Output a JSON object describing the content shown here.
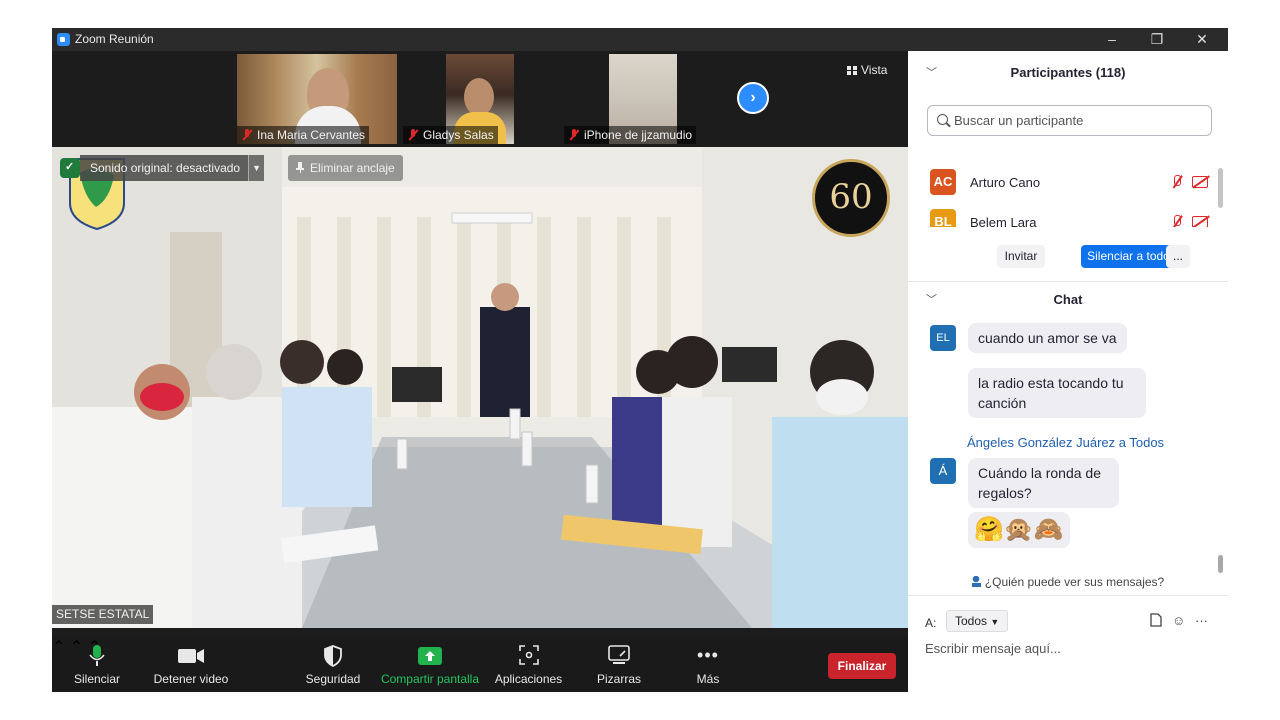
{
  "window": {
    "title": "Zoom Reunión",
    "controls": [
      "–",
      "❐",
      "✕"
    ]
  },
  "thumbnails": [
    {
      "name": "Ina Maria Cervantes"
    },
    {
      "name": "Gladys Salas"
    },
    {
      "name": "iPhone de jjzamudio"
    }
  ],
  "view_label": "Vista",
  "main_video": {
    "speaker": "SETSE ESTATAL",
    "original_sound": "Sonido original: desactivado",
    "unpin": "Eliminar anclaje",
    "badge_number": "60"
  },
  "toolbar": {
    "mute": "Silenciar",
    "stop_video": "Detener video",
    "security": "Seguridad",
    "share": "Compartir pantalla",
    "apps": "Aplicaciones",
    "whiteboards": "Pizarras",
    "more": "Más",
    "end": "Finalizar"
  },
  "participants": {
    "title": "Participantes (118)",
    "search_placeholder": "Buscar un participante",
    "list": [
      {
        "initials": "AC",
        "name": "Arturo Cano",
        "color": "#d9541e"
      },
      {
        "initials": "BL",
        "name": "Belem Lara",
        "color": "#e89a12"
      }
    ],
    "invite": "Invitar",
    "mute_all": "Silenciar a todos",
    "more": "..."
  },
  "chat": {
    "title": "Chat",
    "messages": [
      {
        "avatar": "EL",
        "text": "cuando un amor se va"
      },
      {
        "text": "la radio esta tocando tu canción"
      },
      {
        "sender": "Ángeles González Juárez a Todos",
        "avatar": "Á",
        "text": "Cuándo la ronda de regalos?"
      },
      {
        "text": "🤗🙊🙈"
      }
    ],
    "who_sees": "¿Quién puede ver sus mensajes?",
    "to_label": "A:",
    "to_value": "Todos",
    "input_placeholder": "Escribir mensaje aquí..."
  },
  "colors": {
    "accent": "#2d8cff",
    "end": "#c9232c",
    "share": "#22b24c"
  }
}
